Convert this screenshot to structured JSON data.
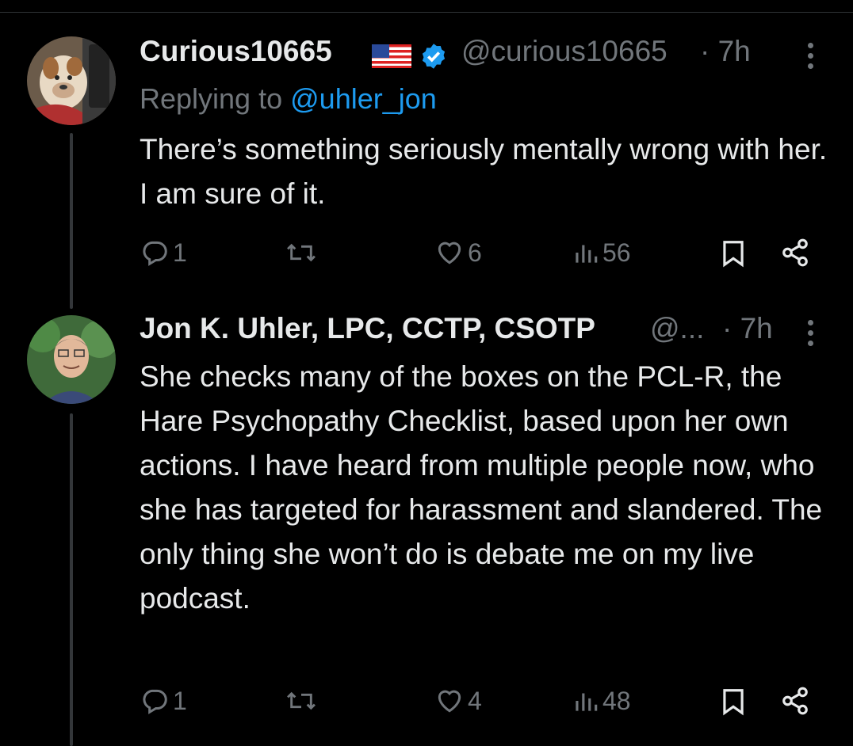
{
  "tweets": [
    {
      "display_name": "Curious10665",
      "flag_icon": "us-flag-icon",
      "verified": true,
      "handle": "@curious10665",
      "time": "· 7h",
      "replying_label": "Replying to",
      "replying_mention": "@uhler_jon",
      "text": "There’s something seriously mentally wrong with her. I am sure of it.",
      "replies": "1",
      "retweets": "",
      "likes": "6",
      "views": "56"
    },
    {
      "display_name": "Jon K. Uhler, LPC, CCTP, CSOTP",
      "handle": "@...",
      "time": "· 7h",
      "text": "She checks many of the boxes on the PCL-R, the Hare Psychopathy Checklist, based upon her own actions. I have heard from multiple people now, who she has targeted for harassment and slandered. The only thing she won’t do is debate me on my live podcast.",
      "replies": "1",
      "retweets": "",
      "likes": "4",
      "views": "48"
    }
  ],
  "colors": {
    "background": "#000000",
    "text": "#e7e9ea",
    "muted": "#71767b",
    "accent": "#1d9bf0",
    "thread_line": "#333639"
  },
  "icons": [
    "reply-icon",
    "retweet-icon",
    "like-icon",
    "views-icon",
    "bookmark-icon",
    "share-icon",
    "more-icon",
    "verified-badge-icon"
  ]
}
